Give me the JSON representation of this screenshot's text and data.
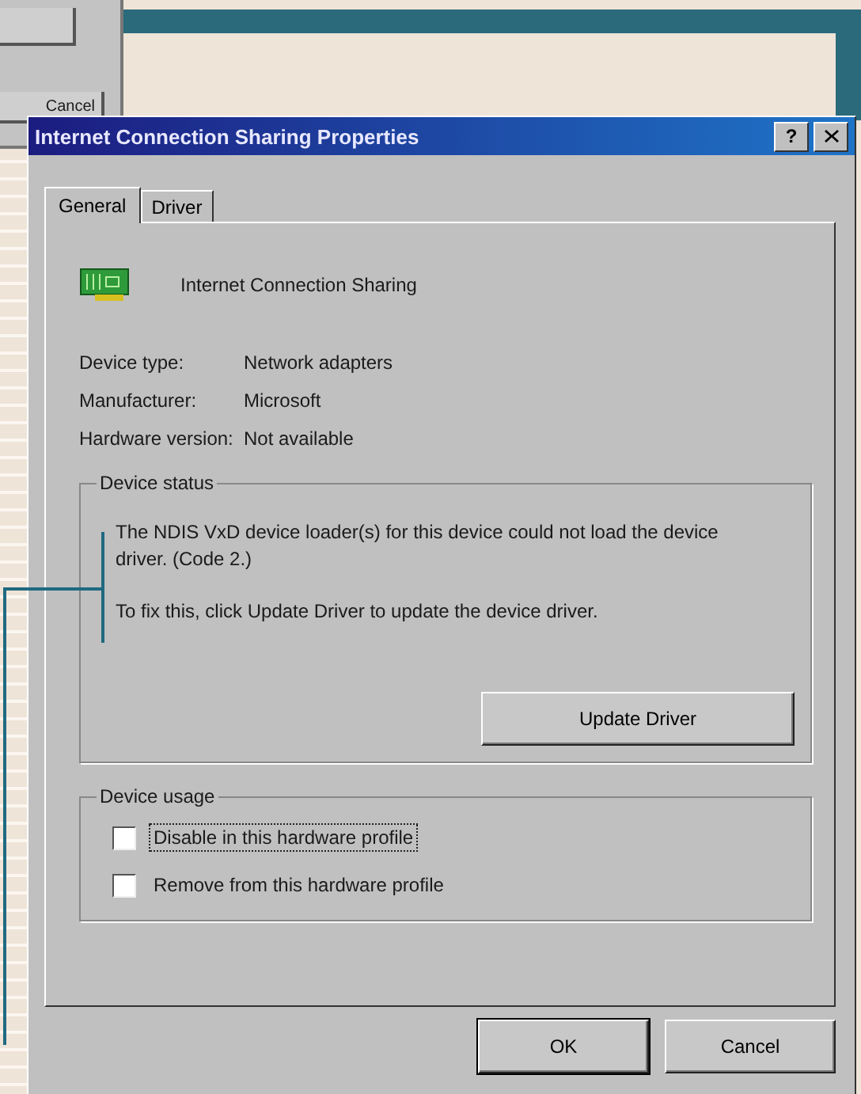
{
  "background_window": {
    "cancel_button": "Cancel"
  },
  "dialog": {
    "title": "Internet Connection Sharing Properties",
    "title_buttons": [
      {
        "kind": "help",
        "label": "?"
      },
      {
        "kind": "close"
      }
    ],
    "tabs": [
      {
        "label": "General",
        "selected": true
      },
      {
        "label": "Driver",
        "selected": false
      }
    ],
    "device_name": "Internet Connection Sharing",
    "properties": [
      {
        "label": "Device type:",
        "value": "Network adapters"
      },
      {
        "label": "Manufacturer:",
        "value": "Microsoft"
      },
      {
        "label": "Hardware version:",
        "value": "Not available"
      }
    ],
    "device_status": {
      "title": "Device status",
      "paragraphs": [
        "The NDIS VxD device loader(s) for this device could not load the device driver.  (Code 2.)",
        "To fix this, click Update Driver to update the device driver."
      ],
      "button": "Update Driver"
    },
    "device_usage": {
      "title": "Device usage",
      "options": [
        {
          "label": "Disable in this hardware profile",
          "checked": false,
          "focused": true
        },
        {
          "label": "Remove from this hardware profile",
          "checked": false,
          "focused": false
        }
      ]
    },
    "buttons": [
      "OK",
      "Cancel"
    ]
  }
}
